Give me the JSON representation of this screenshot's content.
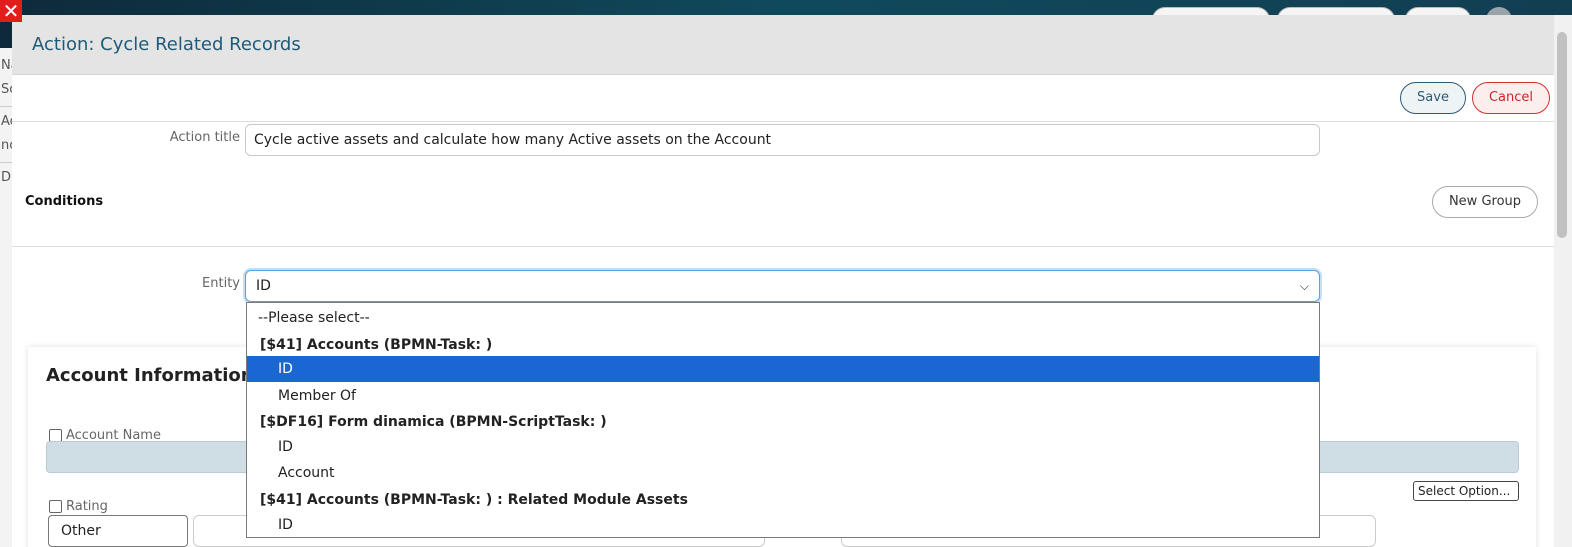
{
  "modal": {
    "title": "Action: Cycle Related Records",
    "save_label": "Save",
    "cancel_label": "Cancel"
  },
  "form": {
    "action_title_label": "Action title",
    "action_title_value": "Cycle active assets and calculate how many Active assets on the Account",
    "conditions_label": "Conditions",
    "new_group_label": "New Group",
    "entity_label": "Entity",
    "entity_value": "ID"
  },
  "dropdown": {
    "options": [
      {
        "text": "--Please select--",
        "kind": "plain"
      },
      {
        "text": "[$41] Accounts (BPMN-Task: )",
        "kind": "group"
      },
      {
        "text": "ID",
        "kind": "child",
        "selected": true
      },
      {
        "text": "Member Of",
        "kind": "child"
      },
      {
        "text": "[$DF16] Form dinamica (BPMN-ScriptTask: )",
        "kind": "group"
      },
      {
        "text": "ID",
        "kind": "child"
      },
      {
        "text": "Account",
        "kind": "child"
      },
      {
        "text": "[$41] Accounts (BPMN-Task: ) : Related Module Assets",
        "kind": "group"
      },
      {
        "text": "ID",
        "kind": "child"
      }
    ]
  },
  "panel": {
    "title": "Account Information",
    "account_name_label": "Account Name",
    "rating_label": "Rating",
    "select_option_label": "Select Option...",
    "other_value": "Other"
  },
  "icons": {
    "close": "close-icon",
    "chevron": "chevron-down-icon"
  },
  "colors": {
    "title": "#1f5a78",
    "selected_option": "#1a66d2",
    "cancel": "#c62828",
    "close": "#e01e1e"
  }
}
